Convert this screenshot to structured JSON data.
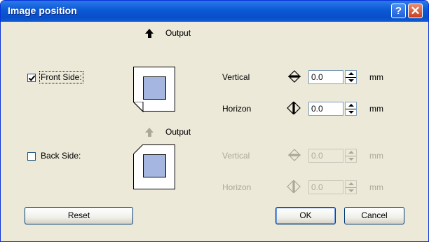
{
  "window": {
    "title": "Image position",
    "help_glyph": "?",
    "close_glyph": "✕"
  },
  "front": {
    "output_label": "Output",
    "checkbox_label": "Front Side:",
    "checked": true,
    "vertical_label": "Vertical",
    "vertical_value": "0.0",
    "vertical_unit": "mm",
    "horizon_label": "Horizon",
    "horizon_value": "0.0",
    "horizon_unit": "mm"
  },
  "back": {
    "output_label": "Output",
    "checkbox_label": "Back Side:",
    "checked": false,
    "vertical_label": "Vertical",
    "vertical_value": "0.0",
    "vertical_unit": "mm",
    "horizon_label": "Horizon",
    "horizon_value": "0.0",
    "horizon_unit": "mm"
  },
  "buttons": {
    "reset": "Reset",
    "ok": "OK",
    "cancel": "Cancel"
  },
  "colors": {
    "title_bar": "#0b58d6",
    "dialog_bg": "#ece9d8",
    "image_fill": "#a5b7e0",
    "disabled_text": "#aca899"
  }
}
